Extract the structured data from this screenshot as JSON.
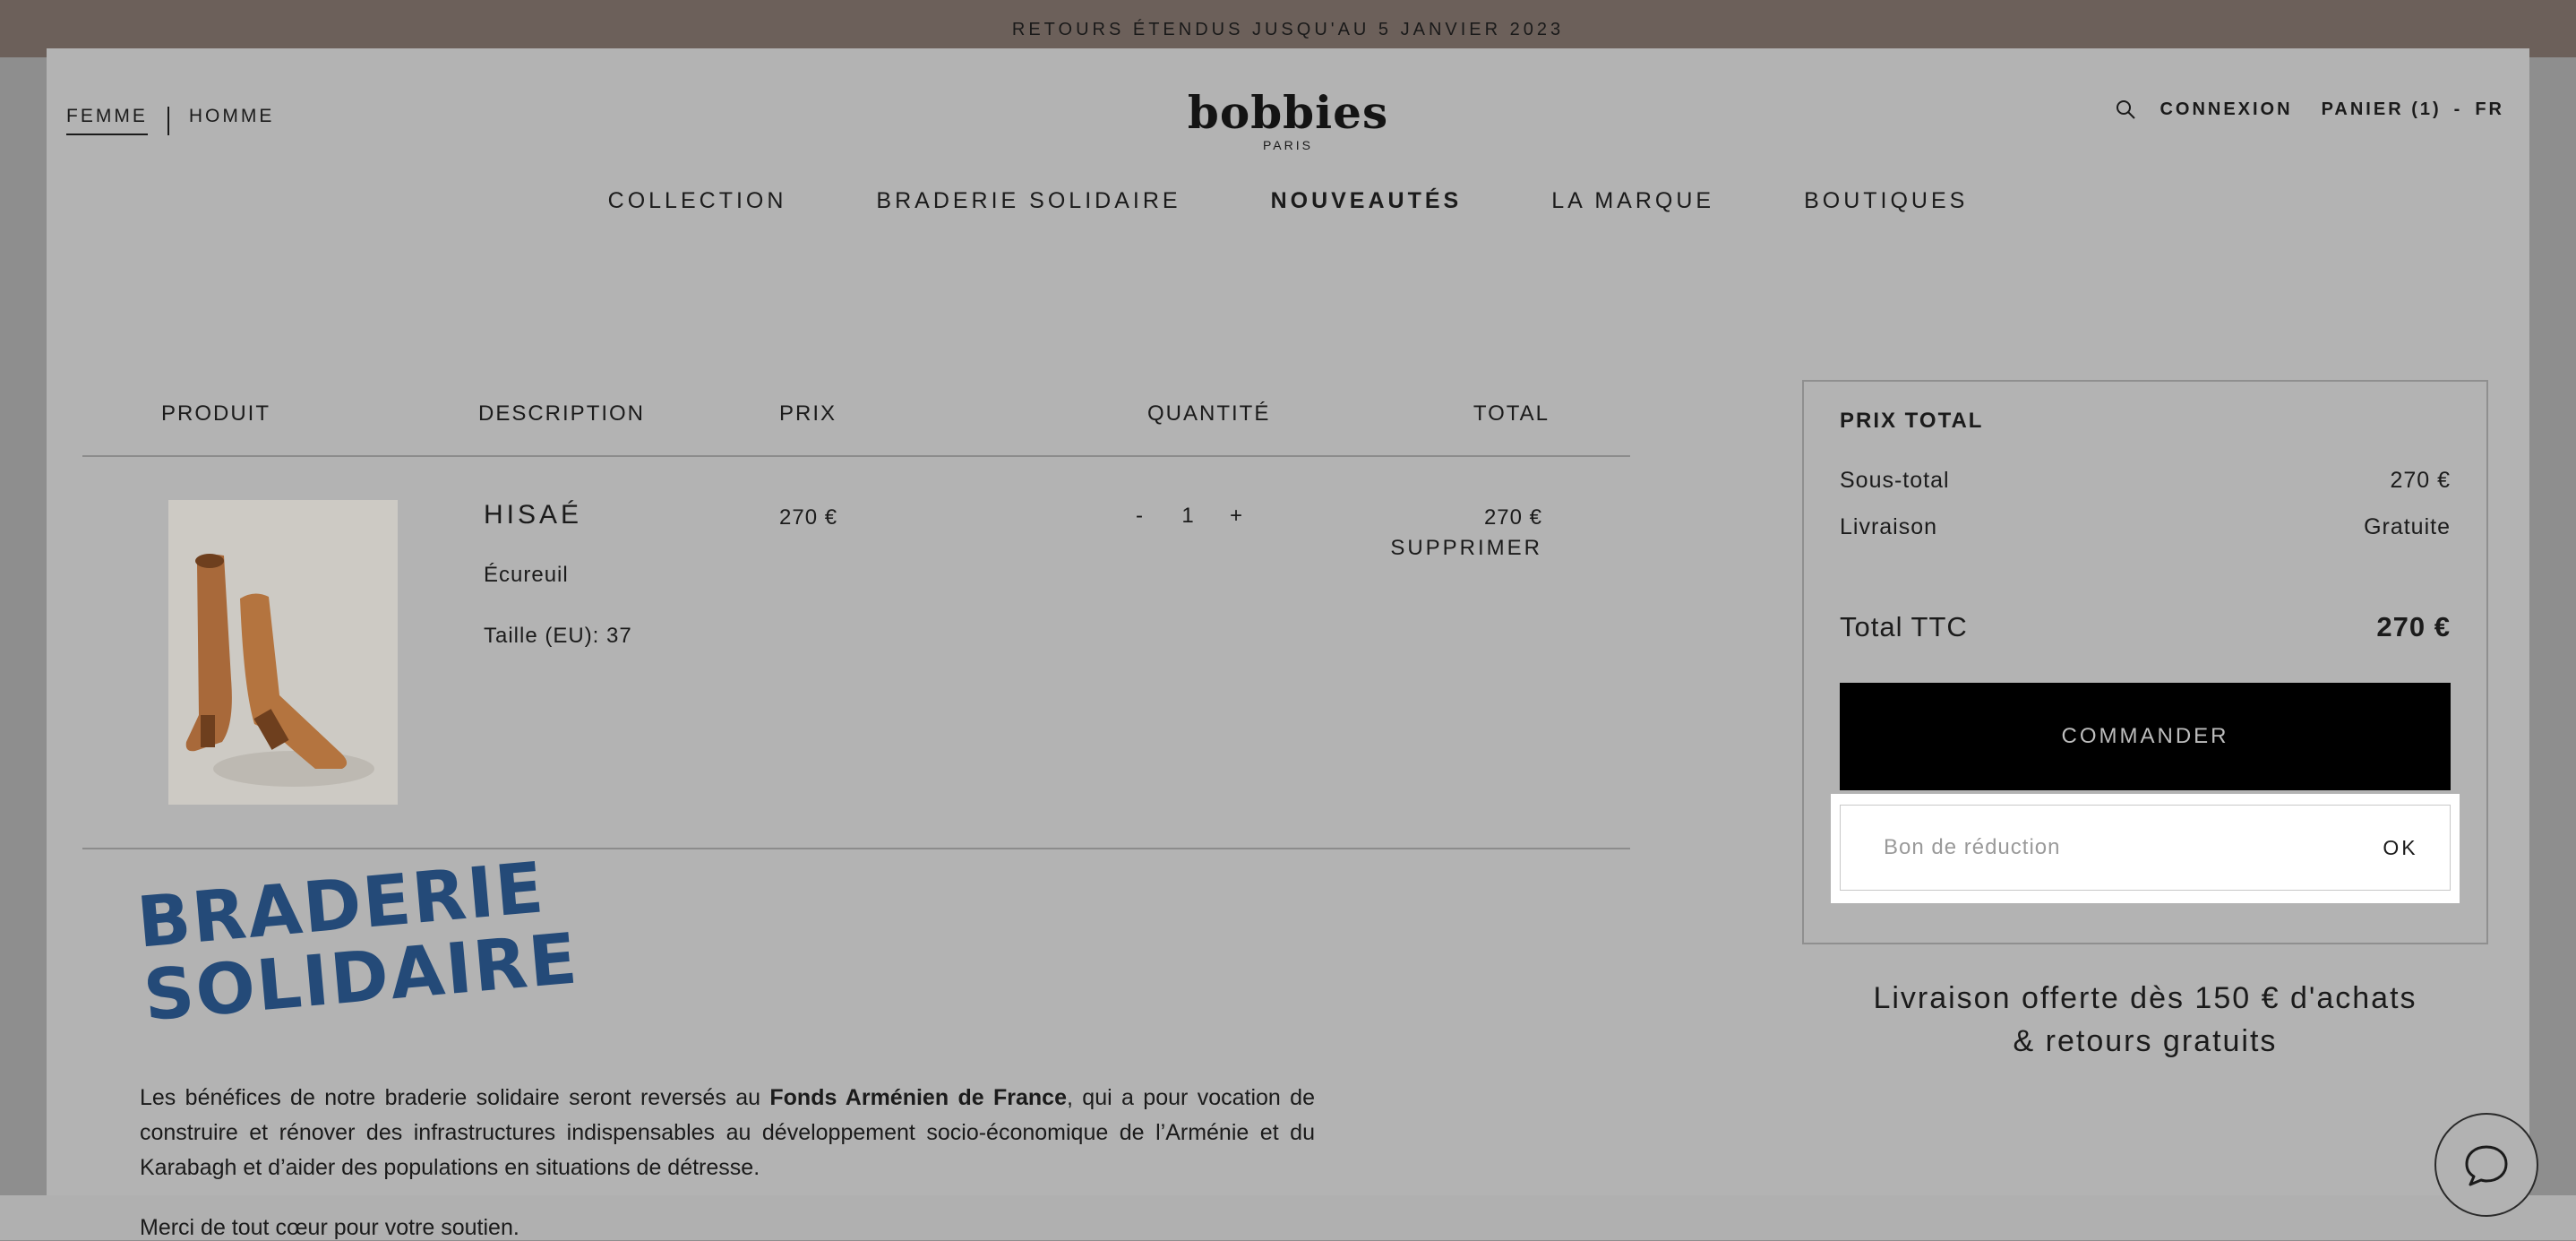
{
  "banner": {
    "text": "RETOURS ÉTENDUS JUSQU'AU 5 JANVIER 2023"
  },
  "header": {
    "gender_active": "FEMME",
    "gender_other": "HOMME",
    "logo_name": "bobbies",
    "logo_city": "PARIS",
    "login": "CONNEXION",
    "cart": "PANIER (1)",
    "cart_sep": "-",
    "lang": "FR"
  },
  "nav": [
    "COLLECTION",
    "BRADERIE SOLIDAIRE",
    "NOUVEAUTÉS",
    "LA MARQUE",
    "BOUTIQUES"
  ],
  "table": {
    "headers": {
      "product": "PRODUIT",
      "description": "DESCRIPTION",
      "price": "PRIX",
      "quantity": "QUANTITÉ",
      "total": "TOTAL"
    }
  },
  "item": {
    "name": "HISAÉ",
    "color": "Écureuil",
    "size": "Taille (EU): 37",
    "price": "270 €",
    "qty_minus": "-",
    "qty": "1",
    "qty_plus": "+",
    "total": "270 €",
    "remove": "SUPPRIMER"
  },
  "braderie": {
    "line1": "BRADERIE",
    "line2": "SOLIDAIRE",
    "color": "#244a78",
    "text_before": "Les bénéfices de notre braderie solidaire seront reversés au ",
    "text_bold": "Fonds Arménien de France",
    "text_after": ", qui a pour vocation de construire et rénover des infrastructures indispensables au développement socio-économique de l’Arménie et du Karabagh et d’aider des populations en situations de détresse.",
    "thanks": "Merci de tout cœur pour votre soutien."
  },
  "summary": {
    "title": "PRIX TOTAL",
    "subtotal_label": "Sous-total",
    "subtotal_value": "270 €",
    "shipping_label": "Livraison",
    "shipping_value": "Gratuite",
    "total_label": "Total TTC",
    "total_value": "270 €",
    "order_button": "COMMANDER",
    "coupon_placeholder": "Bon de réduction",
    "coupon_ok": "OK"
  },
  "promo": {
    "line1": "Livraison offerte dès 150 € d'achats",
    "line2": "& retours gratuits"
  },
  "icons": {
    "search": "search-icon",
    "chat": "chat-bubble-icon",
    "product": "boots-photo"
  }
}
